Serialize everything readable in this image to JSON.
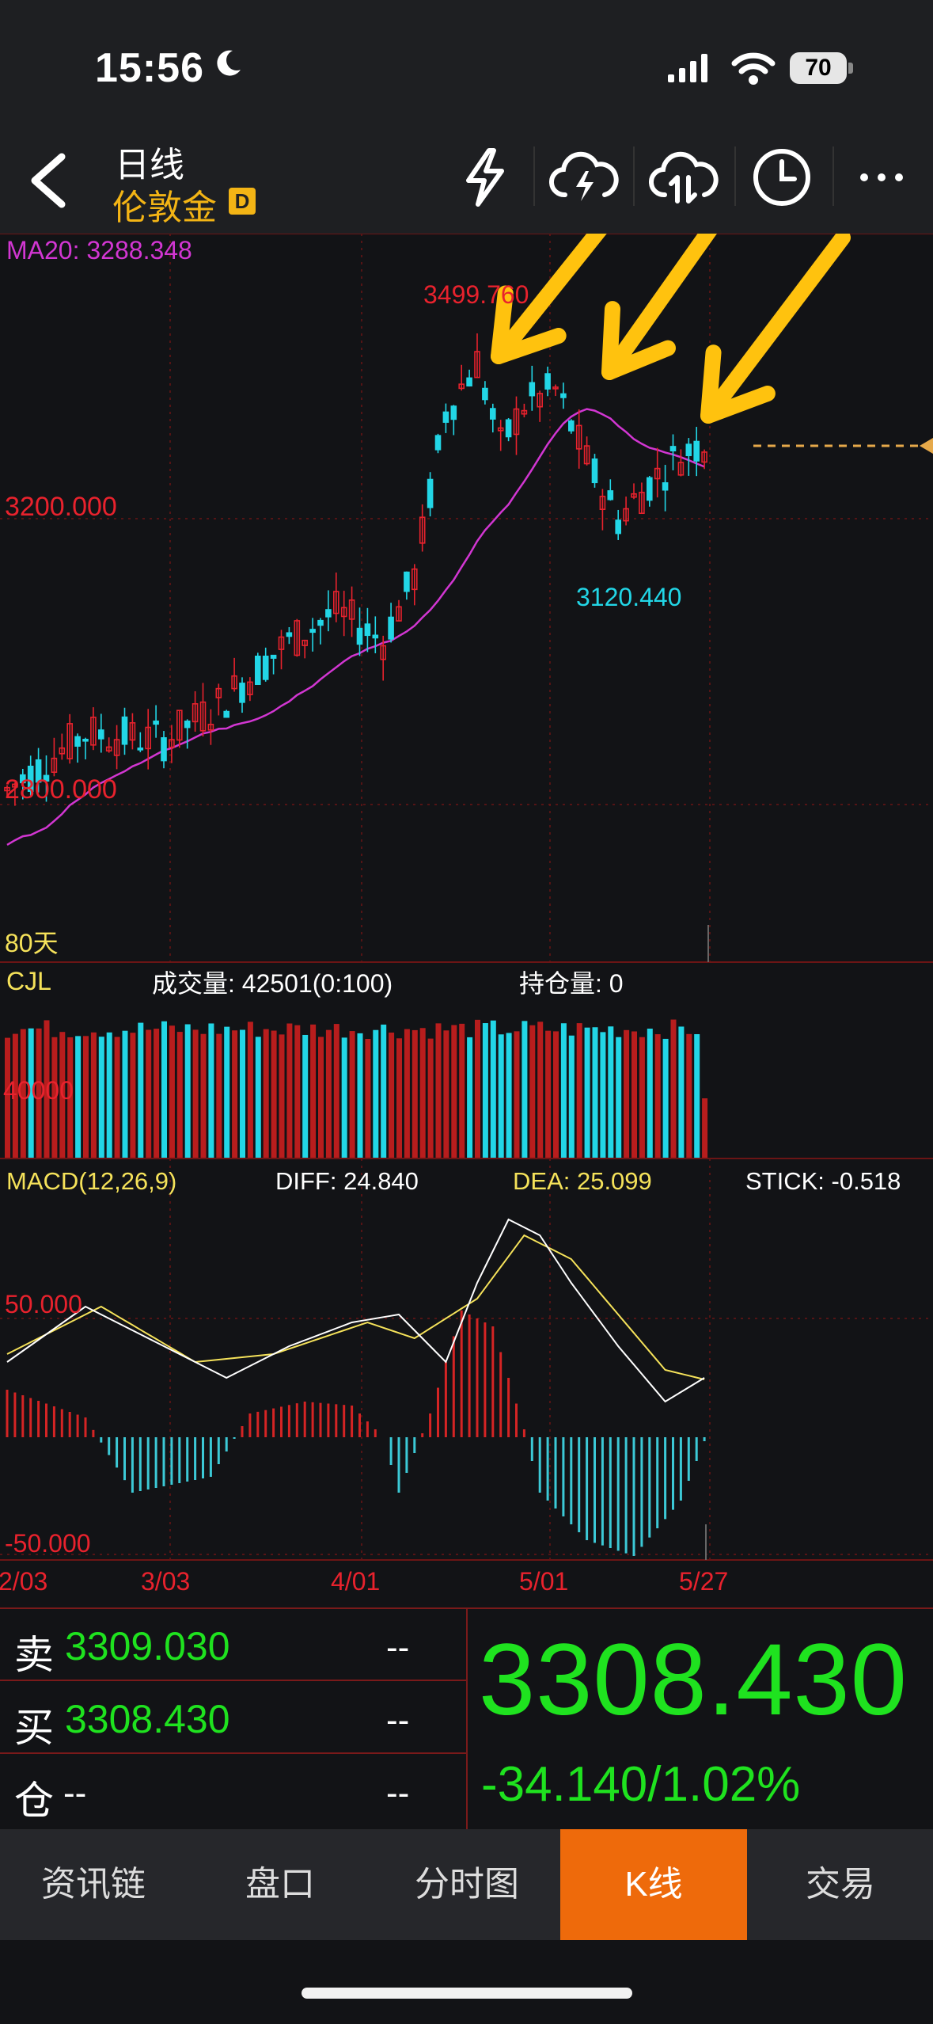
{
  "status_bar": {
    "time": "15:56",
    "battery": "70"
  },
  "header": {
    "period": "日线",
    "instrument": "伦敦金",
    "badge": "D"
  },
  "chart": {
    "ma_label": "MA20: 3288.348",
    "high_label": "3499.760",
    "low_label": "3120.440",
    "price_label_upper": "3200.000",
    "price_label_lower": "2800.000",
    "range_label": "80天",
    "volume": {
      "title": "CJL",
      "volume_text": "成交量: 42501(0:100)",
      "oi_text": "持仓量: 0",
      "axis_label": "40000"
    },
    "macd": {
      "title": "MACD(12,26,9)",
      "diff": "DIFF: 24.840",
      "dea": "DEA: 25.099",
      "stick": "STICK: -0.518",
      "upper_label": "50.000",
      "lower_label": "-50.000"
    },
    "dates": [
      "2/03",
      "3/03",
      "4/01",
      "5/01",
      "5/27"
    ]
  },
  "chart_data": {
    "type": "candlestick",
    "x_ticks": [
      "2/03",
      "3/03",
      "4/01",
      "5/01",
      "5/27"
    ],
    "high": 3499.76,
    "low": 3120.44,
    "ma20": 3288.348,
    "y_labels": [
      3200.0,
      2800.0
    ],
    "volume": 42501,
    "open_interest": 0,
    "macd": {
      "diff": 24.84,
      "dea": 25.099,
      "stick": -0.518
    },
    "colors": {
      "up": "#e8222d",
      "down": "#22d6e6",
      "ma": "#d236d2",
      "diff": "#ffffff",
      "dea": "#f5e25a"
    }
  },
  "quote": {
    "sell_label": "卖",
    "sell_price": "3309.030",
    "sell_qty": "--",
    "buy_label": "买",
    "buy_price": "3308.430",
    "buy_qty": "--",
    "pos_label": "仓",
    "pos_value": "--",
    "pos_qty": "--",
    "last_price": "3308.430",
    "change": "-34.140/1.02%"
  },
  "tabs": [
    {
      "label": "资讯链"
    },
    {
      "label": "盘口"
    },
    {
      "label": "分时图"
    },
    {
      "label": "K线"
    },
    {
      "label": "交易"
    }
  ]
}
